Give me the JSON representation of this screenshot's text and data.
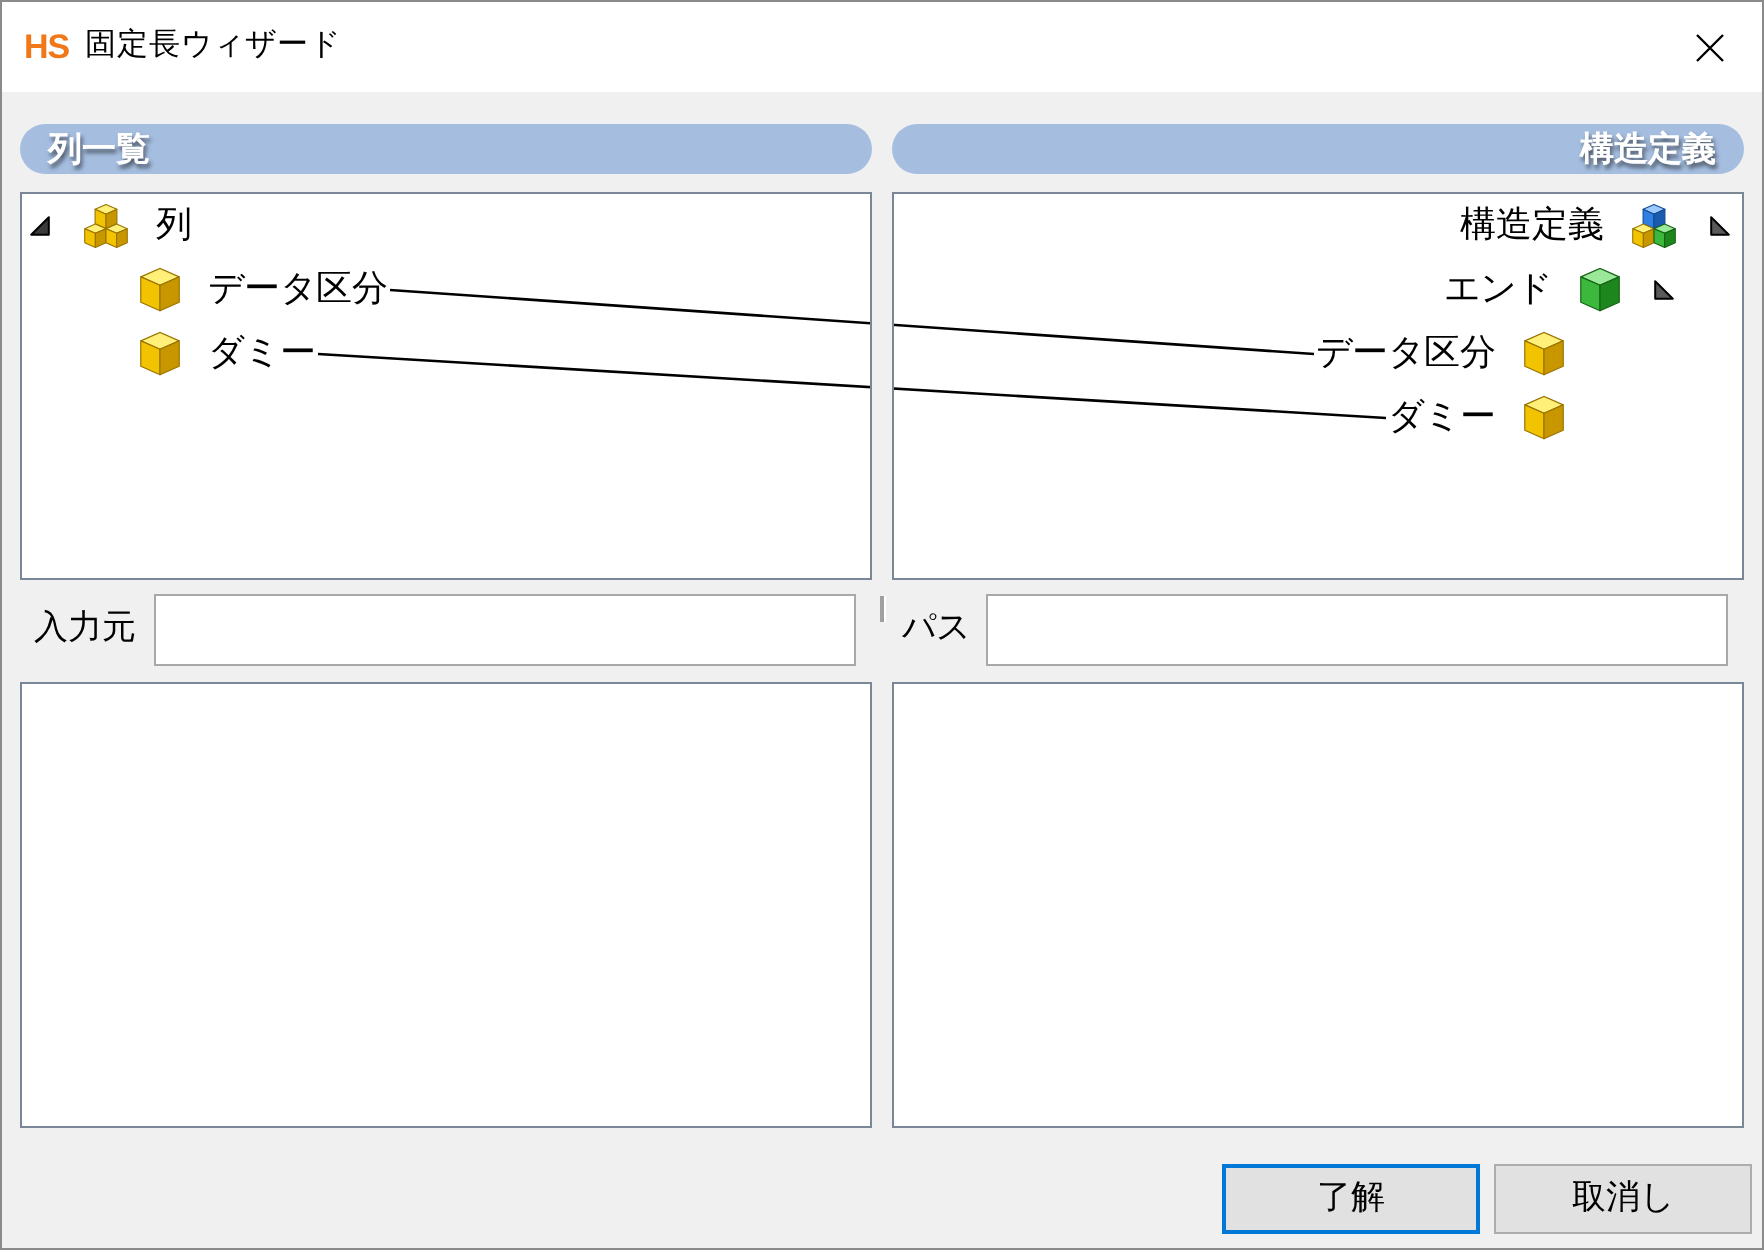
{
  "window": {
    "logo": "HS",
    "title": "固定長ウィザード"
  },
  "source_panel": {
    "header": "列一覧",
    "tree": [
      {
        "label": "列",
        "kind": "columns",
        "expanded": true,
        "children": [
          {
            "label": "データ区分",
            "kind": "field",
            "linked": true
          },
          {
            "label": "ダミー",
            "kind": "field",
            "linked": true
          }
        ]
      }
    ],
    "field": {
      "label": "入力元"
    }
  },
  "target_panel": {
    "header": "構造定義",
    "tree": [
      {
        "label": "構造定義",
        "kind": "structure",
        "expanded": true,
        "children": [
          {
            "label": "エンド",
            "kind": "record",
            "expanded": true,
            "children": [
              {
                "label": "データ区分",
                "kind": "field",
                "linked": true
              },
              {
                "label": "ダミー",
                "kind": "field",
                "linked": true
              }
            ]
          }
        ]
      }
    ],
    "field": {
      "label": "パス"
    }
  },
  "buttons": [
    {
      "label": "了解",
      "default": true
    },
    {
      "label": "取消し",
      "default": false
    }
  ]
}
